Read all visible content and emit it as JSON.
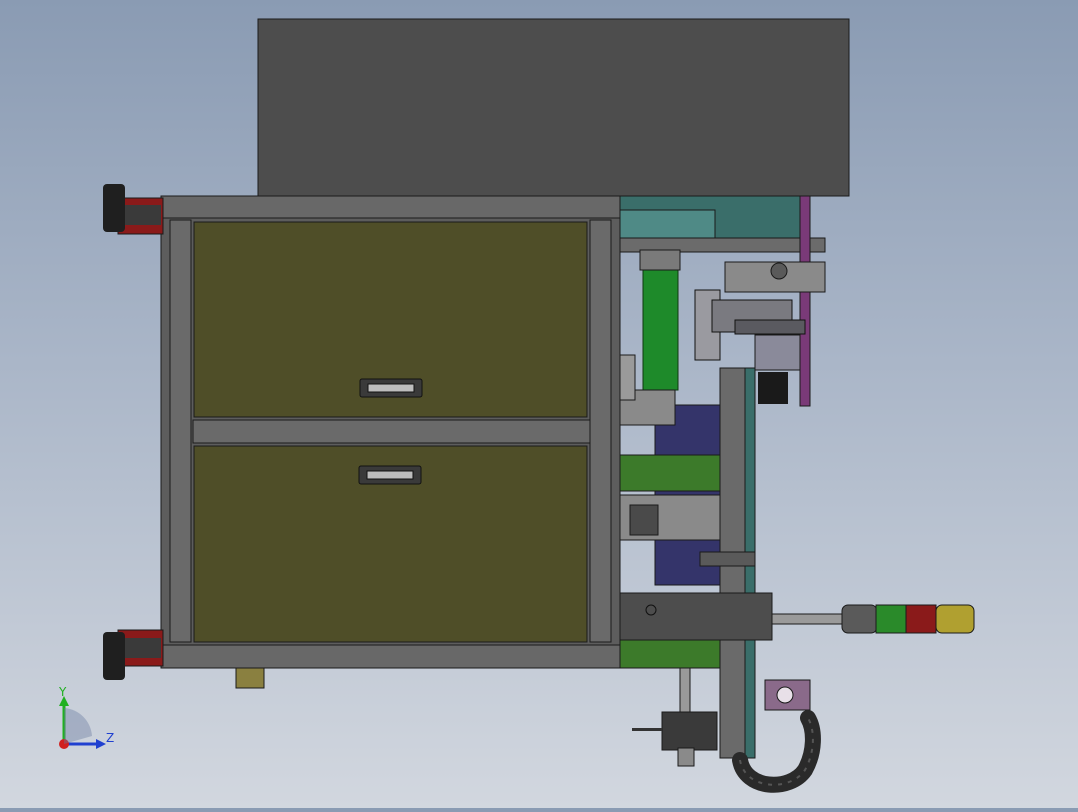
{
  "viewport": {
    "background_top": "#8a9bb3",
    "background_bottom": "#d2d7df"
  },
  "triad": {
    "y_label": "Y",
    "z_label": "Z",
    "x_color": "#d02020",
    "y_color": "#20b020",
    "z_color": "#2040d0"
  },
  "colors": {
    "cabinet_frame": "#5d5d5d",
    "drawer_face": "#4f4e28",
    "top_box": "#4d4d4d",
    "teal_part": "#3a6e6a",
    "green_cylinder": "#1e8a2a",
    "navy_plate": "#34346a",
    "purple_plate": "#7a3a78",
    "tower_light_green": "#2a8a2a",
    "tower_light_red": "#8a1a1a",
    "tower_light_yellow": "#b0a030"
  },
  "icons": {
    "drawer_handle": "drawer-handle-icon",
    "leveling_foot": "leveling-foot-icon",
    "signal_tower": "signal-tower-light-icon",
    "cable_chain": "cable-drag-chain-icon"
  }
}
